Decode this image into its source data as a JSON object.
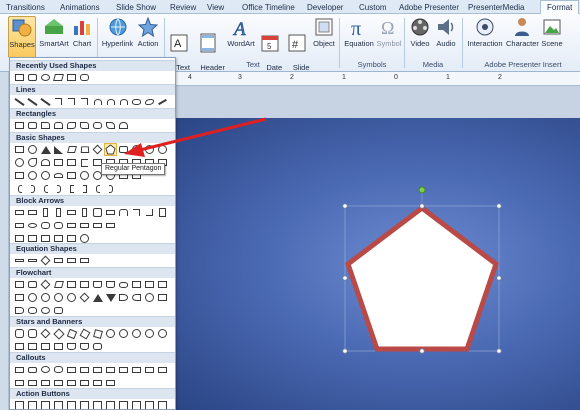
{
  "tabs": [
    "Transitions",
    "Animations",
    "Slide Show",
    "Review",
    "View",
    "Office Timeline",
    "Developer",
    "Custom",
    "Adobe Presenter",
    "PresenterMedia",
    "Format"
  ],
  "ribbon": {
    "buttons": {
      "shapes": "Shapes",
      "smartart": "SmartArt",
      "chart": "Chart",
      "hyperlink": "Hyperlink",
      "action": "Action",
      "textbox": "Text\nBox",
      "header_footer": "Header\n& Footer",
      "wordart": "WordArt",
      "date_time": "Date\n& Time",
      "slide_number": "Slide\nNumber",
      "object": "Object",
      "equation": "Equation",
      "symbol": "Symbol",
      "video": "Video",
      "audio": "Audio",
      "interaction": "Interaction",
      "character": "Character",
      "scene": "Scene"
    },
    "groups": {
      "text": "Text",
      "symbols": "Symbols",
      "media": "Media",
      "adobe": "Adobe Presenter Insert"
    }
  },
  "gallery": {
    "categories": [
      "Recently Used Shapes",
      "Lines",
      "Rectangles",
      "Basic Shapes",
      "Block Arrows",
      "Equation Shapes",
      "Flowchart",
      "Stars and Banners",
      "Callouts",
      "Action Buttons"
    ],
    "tooltip": "Regular Pentagon"
  },
  "ruler": {
    "marks": [
      "4",
      "3",
      "2",
      "1",
      "0",
      "1",
      "2"
    ]
  },
  "colors": {
    "pentagon_fill": "#ffffff",
    "pentagon_border": "#b94a48",
    "arrow": "#e02020",
    "rotate_handle": "#7ed04c"
  }
}
